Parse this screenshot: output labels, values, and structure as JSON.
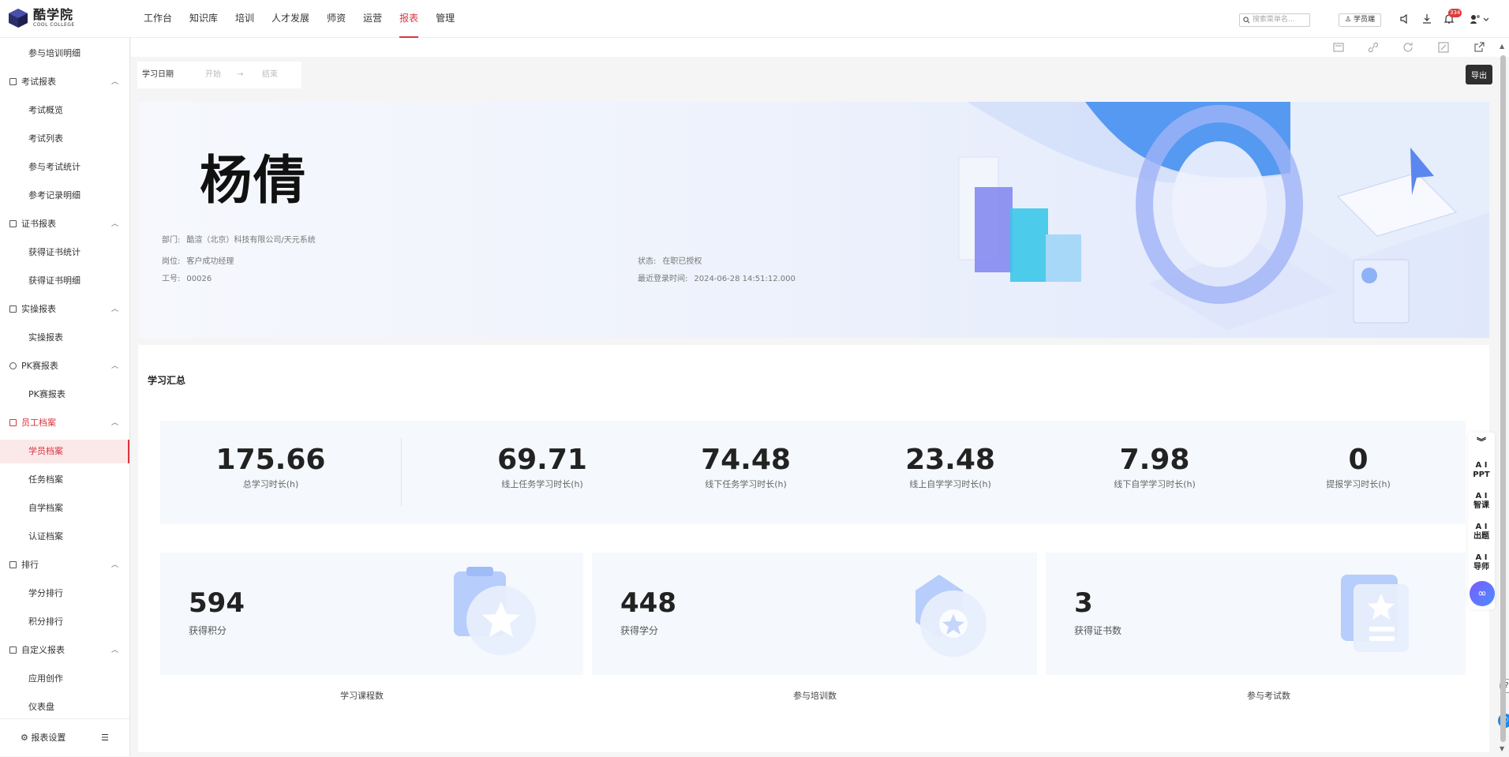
{
  "header": {
    "logo_cn": "酷学院",
    "logo_en": "COOL COLLEGE",
    "nav": [
      "工作台",
      "知识库",
      "培训",
      "人才发展",
      "师资",
      "运营",
      "报表",
      "管理"
    ],
    "active_nav": "报表",
    "search_placeholder": "搜索菜单名...",
    "student_button": "学员端",
    "notification_count": "334"
  },
  "sidebar": {
    "items": [
      {
        "label": "参与培训明细",
        "type": "sub"
      },
      {
        "label": "考试报表",
        "type": "group"
      },
      {
        "label": "考试概览",
        "type": "sub"
      },
      {
        "label": "考试列表",
        "type": "sub"
      },
      {
        "label": "参与考试统计",
        "type": "sub"
      },
      {
        "label": "参考记录明细",
        "type": "sub"
      },
      {
        "label": "证书报表",
        "type": "group"
      },
      {
        "label": "获得证书统计",
        "type": "sub"
      },
      {
        "label": "获得证书明细",
        "type": "sub"
      },
      {
        "label": "实操报表",
        "type": "group"
      },
      {
        "label": "实操报表",
        "type": "sub"
      },
      {
        "label": "PK赛报表",
        "type": "group"
      },
      {
        "label": "PK赛报表",
        "type": "sub"
      },
      {
        "label": "员工档案",
        "type": "group"
      },
      {
        "label": "学员档案",
        "type": "sub"
      },
      {
        "label": "任务档案",
        "type": "sub"
      },
      {
        "label": "自学档案",
        "type": "sub"
      },
      {
        "label": "认证档案",
        "type": "sub"
      },
      {
        "label": "排行",
        "type": "group"
      },
      {
        "label": "学分排行",
        "type": "sub"
      },
      {
        "label": "积分排行",
        "type": "sub"
      },
      {
        "label": "自定义报表",
        "type": "group"
      },
      {
        "label": "应用创作",
        "type": "sub"
      },
      {
        "label": "仪表盘",
        "type": "sub"
      }
    ],
    "footer_label": "报表设置"
  },
  "toolbar": {
    "tooltip": "导出"
  },
  "filter": {
    "label": "学习日期",
    "start_placeholder": "开始",
    "separator": "→",
    "end_placeholder": "结束"
  },
  "profile": {
    "name": "杨倩",
    "dept_label": "部门:",
    "dept_value": "酷渲（北京）科技有限公司/天元系统",
    "position_label": "岗位:",
    "position_value": "客户成功经理",
    "id_label": "工号:",
    "id_value": "00026",
    "status_label": "状态:",
    "status_value": "在职已授权",
    "last_login_label": "最近登录时间:",
    "last_login_value": "2024-06-28 14:51:12.000"
  },
  "summary": {
    "title": "学习汇总",
    "stats": [
      {
        "value": "175.66",
        "label": "总学习时长(h)"
      },
      {
        "value": "69.71",
        "label": "线上任务学习时长(h)"
      },
      {
        "value": "74.48",
        "label": "线下任务学习时长(h)"
      },
      {
        "value": "23.48",
        "label": "线上自学学习时长(h)"
      },
      {
        "value": "7.98",
        "label": "线下自学学习时长(h)"
      },
      {
        "value": "0",
        "label": "提报学习时长(h)"
      }
    ],
    "cards": [
      {
        "value": "594",
        "label": "获得积分",
        "icon": "clipboard-star-icon"
      },
      {
        "value": "448",
        "label": "获得学分",
        "icon": "medal-icon"
      },
      {
        "value": "3",
        "label": "获得证书数",
        "icon": "certificate-icon"
      }
    ],
    "below_labels": [
      "学习课程数",
      "参与培训数",
      "参与考试数"
    ]
  },
  "ai_panel": {
    "items": [
      {
        "top": "A I",
        "bottom": "PPT"
      },
      {
        "top": "A I",
        "bottom": "智课"
      },
      {
        "top": "A I",
        "bottom": "出题"
      },
      {
        "top": "A I",
        "bottom": "导师"
      }
    ]
  },
  "colors": {
    "accent": "#d9363e",
    "panel": "#f5f8fc"
  }
}
